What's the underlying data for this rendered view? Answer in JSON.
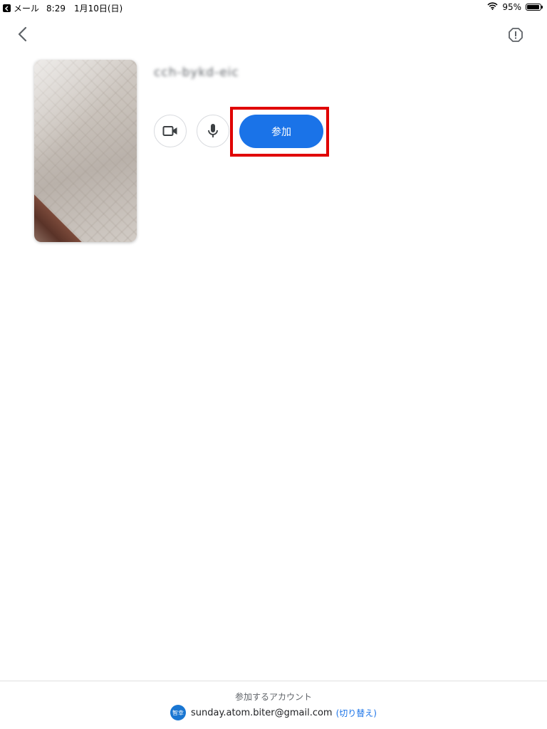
{
  "status_bar": {
    "back_app": "メール",
    "time": "8:29",
    "date": "1月10日(日)",
    "battery_text": "95%",
    "battery_level": 0.95
  },
  "meeting": {
    "code": "cch-bykd-eic"
  },
  "controls": {
    "join_label": "参加"
  },
  "footer": {
    "caption": "参加するアカウント",
    "avatar_text": "智幸",
    "email": "sunday.atom.biter@gmail.com",
    "switch_label": "(切り替え)"
  },
  "colors": {
    "primary": "#1a73e8",
    "highlight": "#e00000",
    "avatar": "#1976d2"
  },
  "icons": [
    "chevron-left-icon",
    "report-icon",
    "camera-icon",
    "mic-icon",
    "wifi-icon",
    "battery-icon"
  ]
}
